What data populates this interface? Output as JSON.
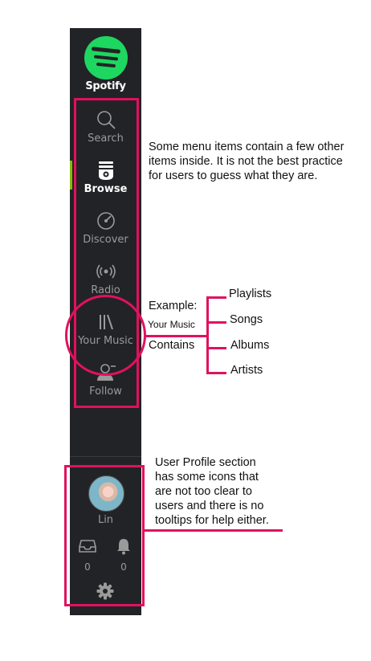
{
  "app": {
    "brand": "Spotify",
    "accent": "#1ed760",
    "highlight_color": "#e0115f"
  },
  "nav": [
    {
      "label": "Search",
      "icon": "search-icon",
      "active": false
    },
    {
      "label": "Browse",
      "icon": "browse-icon",
      "active": true
    },
    {
      "label": "Discover",
      "icon": "discover-icon",
      "active": false
    },
    {
      "label": "Radio",
      "icon": "radio-icon",
      "active": false
    },
    {
      "label": "Your Music",
      "icon": "library-icon",
      "active": false
    },
    {
      "label": "Follow",
      "icon": "follow-icon",
      "active": false
    }
  ],
  "profile": {
    "name": "Lin",
    "inbox_count": "0",
    "notification_count": "0"
  },
  "annotations": {
    "menu_note": [
      "Some menu items contain a few other",
      "items inside. It is not the best practice",
      "for users to guess what they are."
    ],
    "example_label": "Example:",
    "example_item": "Your Music",
    "contains_label": "Contains",
    "contained_items": [
      "Playlists",
      "Songs",
      "Albums",
      "Artists"
    ],
    "profile_note": [
      "User Profile section",
      "has some icons that",
      "are not too clear to",
      "users and there is no",
      "tooltips for help either."
    ]
  }
}
